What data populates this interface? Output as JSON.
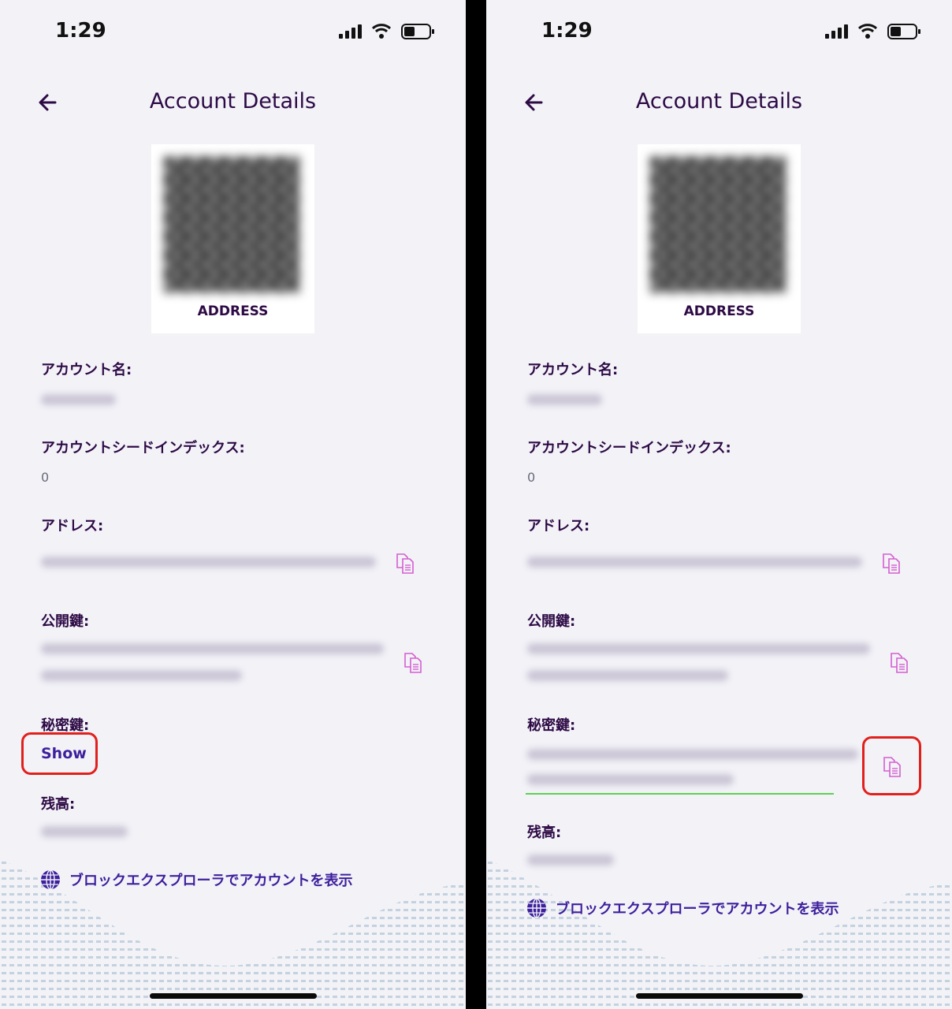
{
  "screens": [
    {
      "status": {
        "time": "1:29"
      },
      "title": "Account Details",
      "qr_label": "ADDRESS",
      "labels": {
        "account_name": "アカウント名:",
        "seed_index": "アカウントシードインデックス:",
        "address": "アドレス:",
        "public_key": "公開鍵:",
        "private_key": "秘密鍵:",
        "balance": "残高:"
      },
      "seed_index_value": "0",
      "show_label": "Show",
      "explorer_link": "ブロックエクスプローラでアカウントを表示"
    },
    {
      "status": {
        "time": "1:29"
      },
      "title": "Account Details",
      "qr_label": "ADDRESS",
      "labels": {
        "account_name": "アカウント名:",
        "seed_index": "アカウントシードインデックス:",
        "address": "アドレス:",
        "public_key": "公開鍵:",
        "private_key": "秘密鍵:",
        "balance": "残高:"
      },
      "seed_index_value": "0",
      "explorer_link": "ブロックエクスプローラでアカウントを表示"
    }
  ],
  "colors": {
    "accent": "#3d1f9c",
    "title": "#2d0a45",
    "copy_icon": "#d45fd0",
    "highlight": "#e1201c",
    "success_underline": "#5fcf55"
  },
  "icons": [
    "back-arrow-icon",
    "copy-icon",
    "globe-icon",
    "signal-icon",
    "wifi-icon",
    "battery-icon"
  ]
}
